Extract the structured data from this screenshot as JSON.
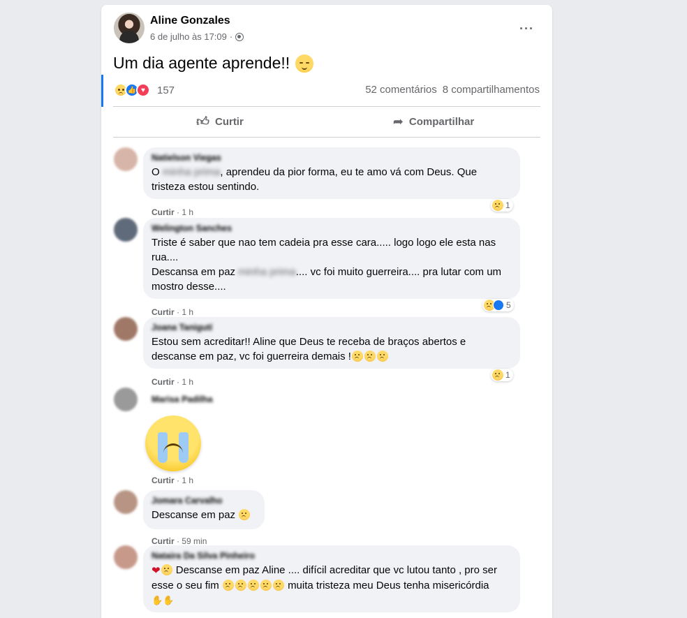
{
  "post": {
    "author": "Aline Gonzales",
    "date": "6 de julho às 17:09",
    "separator": "·",
    "text": "Um dia agente aprende!!",
    "text_emoji": "relieved-face",
    "reactions": [
      "sad",
      "like",
      "love"
    ],
    "reaction_count": "157",
    "comments_count": "52 comentários",
    "shares_count": "8 compartilhamentos",
    "actions": {
      "like": "Curtir",
      "share": "Compartilhar"
    }
  },
  "comments": [
    {
      "name": "Natielson Viegas",
      "text_before": "O ",
      "text_blurred": "minha prima",
      "text_after": ", aprendeu da pior forma, eu te amo vá com Deus. Que tristeza estou sentindo.",
      "like_label": "Curtir",
      "time": "· 1 h",
      "reaction_count": "1"
    },
    {
      "name": "Welington Sanches",
      "line1": "Triste é saber que nao tem cadeia pra esse cara..... logo logo ele esta nas rua....",
      "line2_before": "Descansa em paz ",
      "line2_blurred": "minha prima",
      "line2_after": ".... vc foi muito guerreira.... pra lutar com um mostro desse....",
      "like_label": "Curtir",
      "time": "· 1 h",
      "reaction_count": "5"
    },
    {
      "name": "Joana Tanigutí",
      "text": "Estou sem acreditar!! Aline que Deus te receba de braços abertos e descanse em paz, vc foi guerreira demais !",
      "like_label": "Curtir",
      "time": "· 1 h",
      "reaction_count": "1"
    },
    {
      "name": "Marisa Padilha",
      "sticker": "crying-face-sticker",
      "like_label": "Curtir",
      "time": "· 1 h"
    },
    {
      "name": "Jomara Carvalho",
      "text": "Descanse em paz",
      "like_label": "Curtir",
      "time": "· 59 min"
    },
    {
      "name": "Nataira Da Silva Pinheiro",
      "text_a": "Descanse em paz Aline .... difícil acreditar que vc lutou tanto , pro ser esse o seu fim",
      "text_b": "muita tristeza meu Deus tenha misericórdia"
    }
  ],
  "colors": {
    "accent": "#1877f2",
    "meta": "#65676b",
    "bubble": "#f0f2f5",
    "love": "#f33e58"
  }
}
